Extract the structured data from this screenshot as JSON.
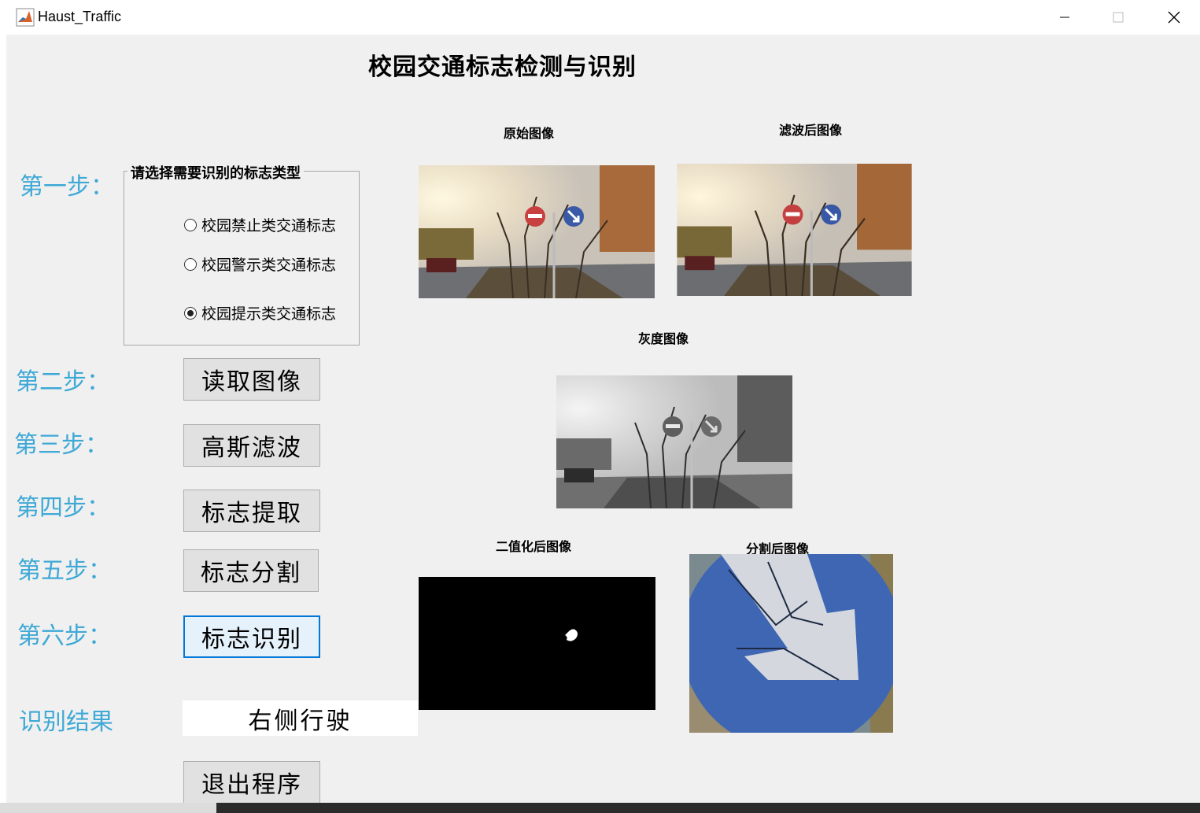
{
  "window": {
    "title": "Haust_Traffic"
  },
  "main_title": "校园交通标志检测与识别",
  "steps": {
    "step1": "第一步：",
    "step2": "第二步：",
    "step3": "第三步：",
    "step4": "第四步：",
    "step5": "第五步：",
    "step6": "第六步："
  },
  "panel": {
    "title": "请选择需要识别的标志类型",
    "options": [
      {
        "label": "校园禁止类交通标志",
        "selected": false
      },
      {
        "label": "校园警示类交通标志",
        "selected": false
      },
      {
        "label": "校园提示类交通标志",
        "selected": true
      }
    ]
  },
  "buttons": {
    "read_image": "读取图像",
    "gaussian_filter": "高斯滤波",
    "sign_extract": "标志提取",
    "sign_segment": "标志分割",
    "sign_recognize": "标志识别",
    "exit": "退出程序"
  },
  "images": {
    "original": "原始图像",
    "filtered": "滤波后图像",
    "gray": "灰度图像",
    "binary": "二值化后图像",
    "segmented": "分割后图像"
  },
  "result": {
    "label": "识别结果",
    "value": "右侧行驶"
  },
  "colors": {
    "step_text": "#3fa9d6",
    "window_bg": "#f0f0f0",
    "button_bg": "#e1e1e1",
    "focus_border": "#0078d7"
  }
}
